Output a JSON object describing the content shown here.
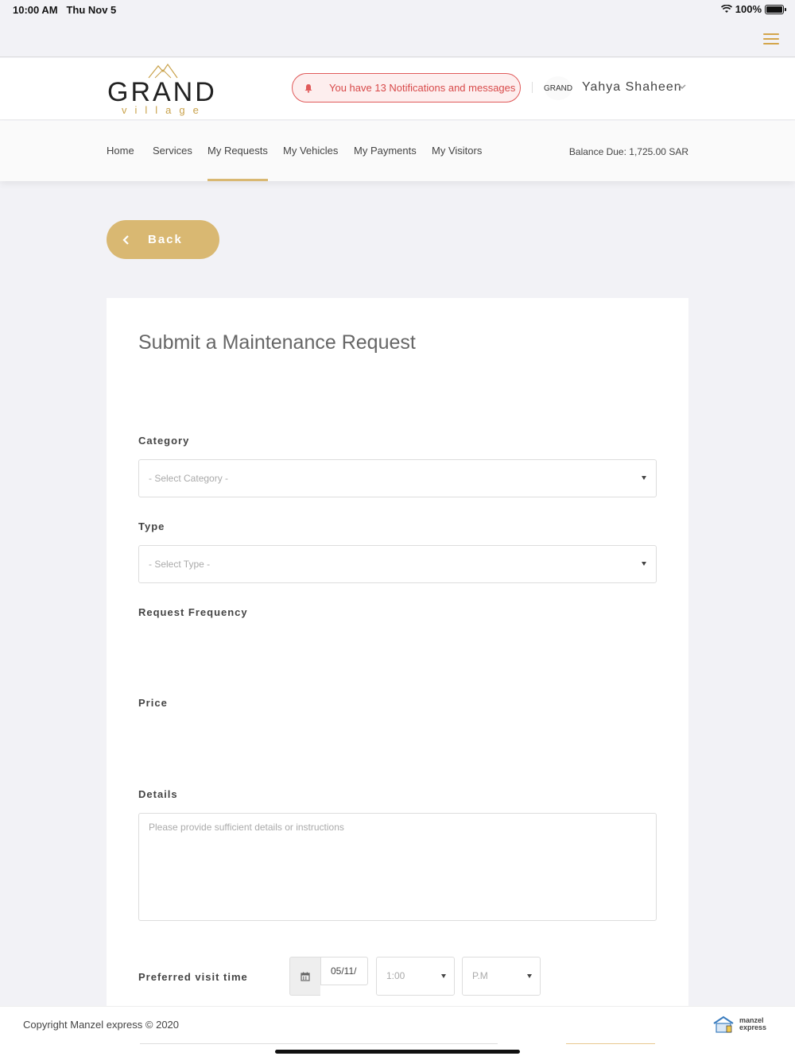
{
  "status_bar": {
    "time": "10:00 AM",
    "date": "Thu Nov 5",
    "battery": "100%"
  },
  "header": {
    "logo_main": "GRAND",
    "logo_sub": "village",
    "notification": "You have 13 Notifications and messages",
    "avatar_text": "GRAND",
    "user_name": "Yahya Shaheen"
  },
  "nav": {
    "items": [
      {
        "label": "Home"
      },
      {
        "label": "Services"
      },
      {
        "label": "My Requests"
      },
      {
        "label": "My Vehicles"
      },
      {
        "label": "My Payments"
      },
      {
        "label": "My Visitors"
      }
    ],
    "active": "My Requests",
    "balance": "Balance Due: 1,725.00 SAR"
  },
  "back_label": "Back",
  "form": {
    "title": "Submit a Maintenance Request",
    "category_label": "Category",
    "category_placeholder": "- Select Category -",
    "type_label": "Type",
    "type_placeholder": "- Select Type -",
    "frequency_label": "Request Frequency",
    "price_label": "Price",
    "details_label": "Details",
    "details_placeholder": "Please provide sufficient details or instructions",
    "visit_label": "Preferred visit time",
    "date_value": "05/11/",
    "time_value": "1:00",
    "ampm_value": "P.M"
  },
  "footer": {
    "copyright": "Copyright Manzel express © 2020",
    "brand_line1": "manzel",
    "brand_line2": "express"
  },
  "colors": {
    "accent": "#d9b872",
    "notify": "#e05a5a",
    "gold": "#c9a24b"
  }
}
